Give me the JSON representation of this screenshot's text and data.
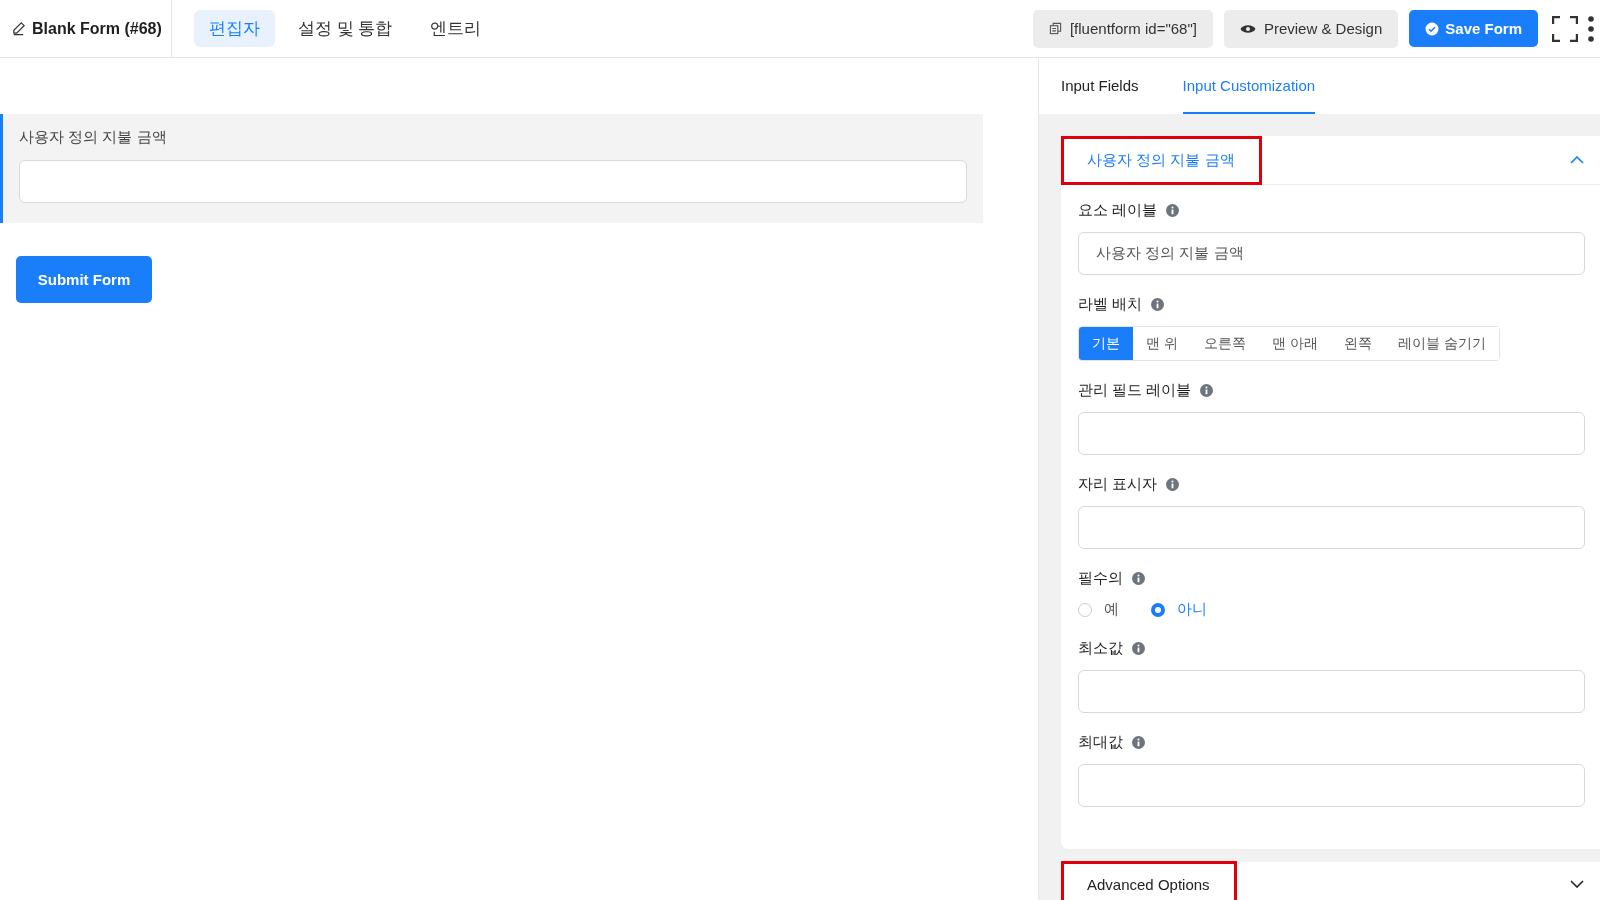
{
  "header": {
    "form_title": "Blank Form (#68)",
    "tabs": [
      {
        "label": "편집자",
        "selected": true
      },
      {
        "label": "설정 및 통합",
        "selected": false
      },
      {
        "label": "엔트리",
        "selected": false
      }
    ],
    "shortcode": "[fluentform id=\"68\"]",
    "preview_button": "Preview & Design",
    "save_button": "Save Form"
  },
  "canvas": {
    "field": {
      "label": "사용자 정의 지불 금액"
    },
    "submit_button": "Submit Form"
  },
  "panel": {
    "tabs": [
      {
        "label": "Input Fields",
        "selected": false
      },
      {
        "label": "Input Customization",
        "selected": true
      }
    ],
    "section": {
      "title": "사용자 정의 지불 금액",
      "expanded": true,
      "highlighted": true,
      "settings": [
        {
          "kind": "text",
          "label": "요소 레이블",
          "value": "사용자 정의 지불 금액"
        },
        {
          "kind": "segmented",
          "label": "라벨 배치",
          "options": [
            {
              "label": "기본",
              "selected": true
            },
            {
              "label": "맨 위",
              "selected": false
            },
            {
              "label": "오른쪽",
              "selected": false
            },
            {
              "label": "맨 아래",
              "selected": false
            },
            {
              "label": "왼쪽",
              "selected": false
            },
            {
              "label": "레이블 숨기기",
              "selected": false
            }
          ]
        },
        {
          "kind": "text",
          "label": "관리 필드 레이블"
        },
        {
          "kind": "text",
          "label": "자리 표시자"
        },
        {
          "kind": "radio",
          "label": "필수의",
          "options": [
            {
              "label": "예",
              "selected": false
            },
            {
              "label": "아니",
              "selected": true
            }
          ]
        },
        {
          "kind": "text",
          "label": "최소값"
        },
        {
          "kind": "text",
          "label": "최대값"
        }
      ]
    },
    "advanced": {
      "title": "Advanced Options",
      "expanded": false,
      "highlighted": true
    }
  }
}
